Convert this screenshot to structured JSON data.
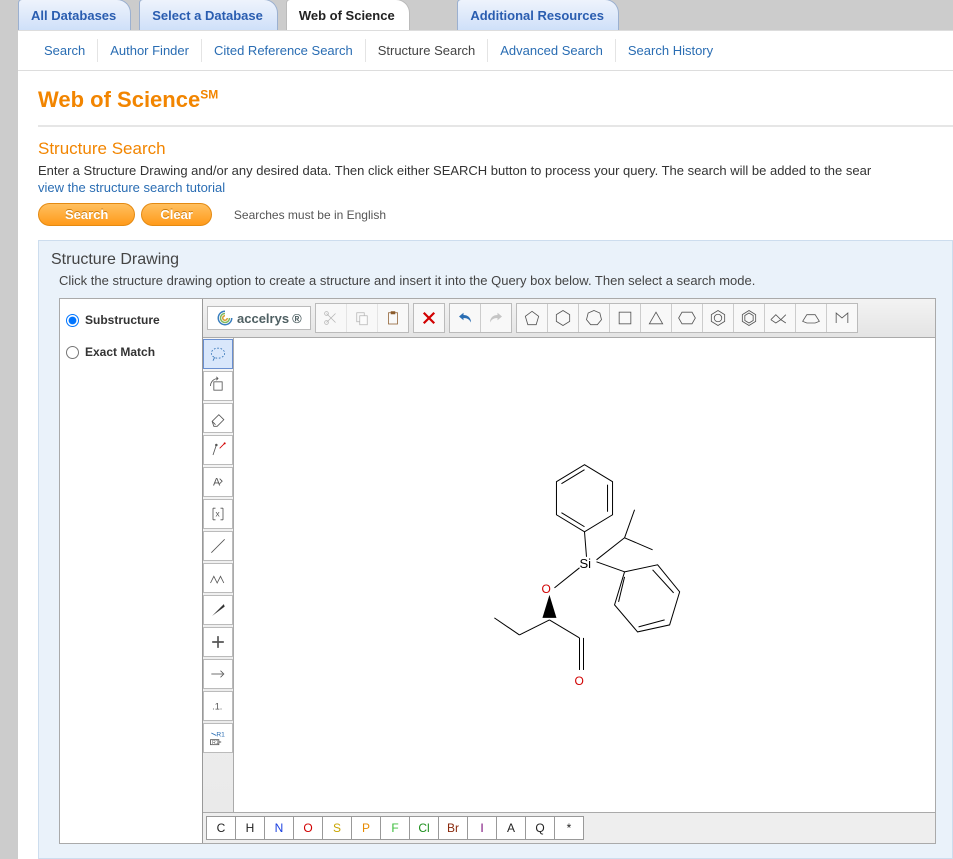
{
  "top_tabs": {
    "all": "All Databases",
    "select": "Select a Database",
    "wos": "Web of Science",
    "addl": "Additional Resources"
  },
  "sub_tabs": {
    "search": "Search",
    "author": "Author Finder",
    "cited": "Cited Reference Search",
    "structure": "Structure Search",
    "advanced": "Advanced Search",
    "history": "Search History"
  },
  "brand": {
    "name": "Web of Science",
    "sm": "SM"
  },
  "section_title": "Structure Search",
  "intro": "Enter a Structure Drawing and/or any desired data. Then click either SEARCH button to process your query. The search will be added to the sear",
  "tutorial_link": "view the structure search tutorial",
  "buttons": {
    "search": "Search",
    "clear": "Clear"
  },
  "hint": "Searches must be in English",
  "drawing": {
    "title": "Structure Drawing",
    "sub": "Click the structure drawing option to create a structure and insert it into the Query box below. Then select a search mode."
  },
  "modes": {
    "substructure": "Substructure",
    "exact": "Exact Match"
  },
  "accelrys": {
    "label": "accelrys",
    "reg": "®"
  },
  "bottom_atoms": [
    "C",
    "H",
    "N",
    "O",
    "S",
    "P",
    "F",
    "Cl",
    "Br",
    "I",
    "A",
    "Q",
    "*"
  ],
  "molecule_atoms": {
    "si": "Si",
    "o1": "O",
    "o2": "O"
  }
}
